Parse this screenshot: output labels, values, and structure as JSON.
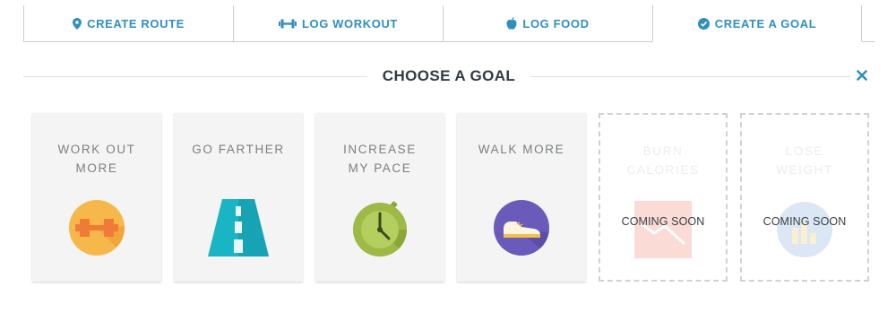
{
  "tabs": [
    {
      "label": "CREATE ROUTE",
      "icon": "map-pin-icon"
    },
    {
      "label": "LOG WORKOUT",
      "icon": "dumbbell-icon"
    },
    {
      "label": "LOG FOOD",
      "icon": "apple-icon"
    },
    {
      "label": "CREATE A GOAL",
      "icon": "check-circle-icon",
      "active": true
    }
  ],
  "heading": "CHOOSE A GOAL",
  "close_icon": "close-icon",
  "goals": [
    {
      "label": "WORK OUT\nMORE",
      "icon": "dumbbell-badge-icon",
      "color": "#f7b84b"
    },
    {
      "label": "GO FARTHER",
      "icon": "road-badge-icon",
      "color": "#1ab5c4"
    },
    {
      "label": "INCREASE\nMY PACE",
      "icon": "stopwatch-badge-icon",
      "color": "#9cba45"
    },
    {
      "label": "WALK MORE",
      "icon": "shoe-badge-icon",
      "color": "#6a5bbb"
    },
    {
      "label": "BURN\nCALORIES",
      "icon": "chart-down-badge-icon",
      "color": "#f39a8a",
      "status": "COMING SOON"
    },
    {
      "label": "LOSE\nWEIGHT",
      "icon": "bar-chart-badge-icon",
      "color": "#9bbbe0",
      "status": "COMING SOON"
    }
  ],
  "colors": {
    "accent": "#2f8fc1",
    "heading": "#333a40",
    "card_bg": "#f4f4f4"
  }
}
